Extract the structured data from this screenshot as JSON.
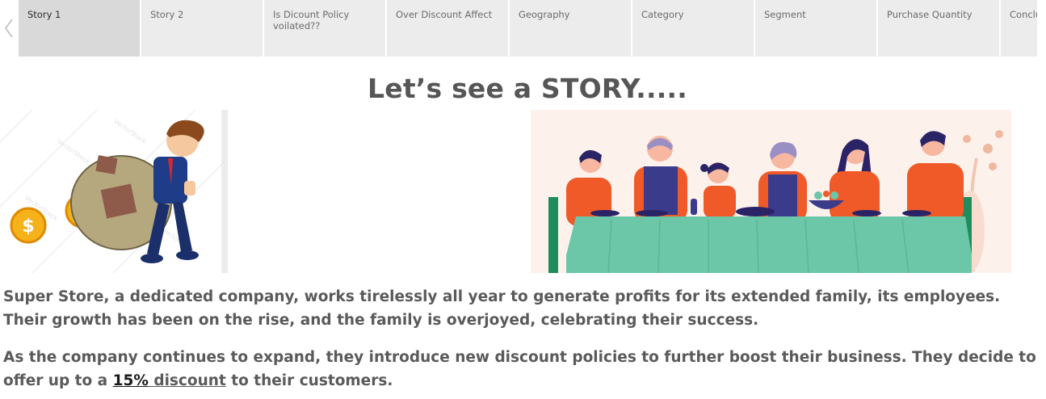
{
  "tabs": [
    {
      "label": "Story 1",
      "active": true
    },
    {
      "label": "Story 2",
      "active": false
    },
    {
      "label": "Is Dicount Policy voilated??",
      "active": false
    },
    {
      "label": "Over Discount Affect",
      "active": false
    },
    {
      "label": "Geography",
      "active": false
    },
    {
      "label": "Category",
      "active": false
    },
    {
      "label": "Segment",
      "active": false
    },
    {
      "label": "Purchase Quantity",
      "active": false
    },
    {
      "label": "Conclu",
      "active": false
    }
  ],
  "title": "Let’s see a STORY.....",
  "paragraph1": "Super Store, a dedicated company, works tirelessly all year to generate profits for its extended family, its employees. Their growth has been on the rise, and the family is overjoyed, celebrating their success.",
  "paragraph2": {
    "before": "As the company continues to expand, they introduce new discount policies to further boost their business. They decide to offer up to a ",
    "highlight": "15%",
    "space": " ",
    "underlined": "discount",
    "after": " to their customers."
  },
  "watermark": "VectorStock",
  "icons": {
    "prev": "chevron-left-icon",
    "left_image": "businessman-carrying-money-bag-illustration",
    "right_image": "family-dinner-illustration"
  },
  "colors": {
    "tab_bg": "#ececec",
    "tab_active_bg": "#d9d9d9",
    "text": "#5a5a5a",
    "tablecloth": "#6cc7a8",
    "shirt_orange": "#f05a28"
  }
}
